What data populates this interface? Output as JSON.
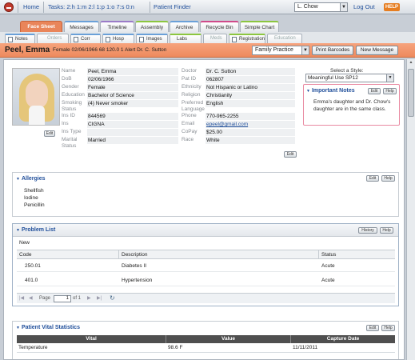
{
  "topbar": {
    "home": "Home",
    "tasks": "Tasks: 2:h 1:m 2:l 1:p 1:o 7:s 0:n",
    "patient_finder": "Patient Finder",
    "user": "L. Chow",
    "logout": "Log Out",
    "help": "HELP"
  },
  "tabs": [
    "Face Sheet",
    "Messages",
    "Timeline",
    "Assembly",
    "Archive",
    "Recycle Bin",
    "Simple Chart"
  ],
  "subtabs": [
    {
      "label": "Notes",
      "disabled": false
    },
    {
      "label": "Orders",
      "disabled": true
    },
    {
      "label": "Corr",
      "disabled": false
    },
    {
      "label": "Hosp",
      "disabled": false
    },
    {
      "label": "Images",
      "disabled": false
    },
    {
      "label": "Labs",
      "disabled": false
    },
    {
      "label": "Meds",
      "disabled": true
    },
    {
      "label": "Registration",
      "disabled": false
    },
    {
      "label": "Education",
      "disabled": true
    }
  ],
  "patient": {
    "name": "Peel, Emma",
    "info": "Female  02/06/1966  68  120.0  1 Alert  Dr. C. Sutton",
    "practice": "Family Practice",
    "print_barcodes": "Print Barcodes",
    "new_message": "New Message"
  },
  "demographics": {
    "edit_photo": "Edit",
    "edit": "Edit",
    "left": [
      {
        "label": "Name",
        "value": "Peel, Emma"
      },
      {
        "label": "DoB",
        "value": "02/06/1966"
      },
      {
        "label": "Gender",
        "value": "Female"
      },
      {
        "label": "Education",
        "value": "Bachelor of Science"
      },
      {
        "label": "Smoking Status",
        "value": "(4) Never smoker"
      },
      {
        "label": "Ins ID",
        "value": "844569"
      },
      {
        "label": "Ins",
        "value": "CIGNA"
      },
      {
        "label": "Ins Type",
        "value": ""
      },
      {
        "label": "Marital Status",
        "value": "Married"
      }
    ],
    "right": [
      {
        "label": "Doctor",
        "value": "Dr. C. Sutton"
      },
      {
        "label": "Pat ID",
        "value": "062807"
      },
      {
        "label": "Ethnicity",
        "value": "Not Hispanic or Latino"
      },
      {
        "label": "Religion",
        "value": "Christianity"
      },
      {
        "label": "Preferred Language",
        "value": "English"
      },
      {
        "label": "Phone",
        "value": "770-965-2255"
      },
      {
        "label": "Email",
        "value": "epeel@gmail.com"
      },
      {
        "label": "CoPay",
        "value": "$25.00"
      },
      {
        "label": "Race",
        "value": "White"
      }
    ]
  },
  "style": {
    "label": "Select a Style:",
    "value": "Meaningful Use SP12"
  },
  "important_notes": {
    "title": "Important Notes",
    "edit": "Edit",
    "help": "Help",
    "text": "Emma's daughter and Dr. Chow's daughter are in the same class."
  },
  "allergies": {
    "title": "Allergies",
    "edit": "Edit",
    "help": "Help",
    "items": [
      "Shellfish",
      "Iodine",
      "Penicillin"
    ]
  },
  "problem_list": {
    "title": "Problem List",
    "history": "History",
    "help": "Help",
    "new": "New",
    "columns": [
      "Code",
      "Description",
      "Status"
    ],
    "rows": [
      {
        "code": "250.01",
        "description": "Diabetes II",
        "status": "Acute"
      },
      {
        "code": "401.0",
        "description": "Hypertension",
        "status": "Acute"
      }
    ],
    "pager": {
      "page_label": "Page",
      "page": "1",
      "of": "of 1"
    }
  },
  "vitals": {
    "title": "Patient Vital Statistics",
    "edit": "Edit",
    "help": "Help",
    "columns": [
      "Vital",
      "Value",
      "Capture Date"
    ],
    "rows": [
      {
        "vital": "Temperature",
        "value": "98.6 F",
        "date": "11/11/2011"
      }
    ]
  }
}
